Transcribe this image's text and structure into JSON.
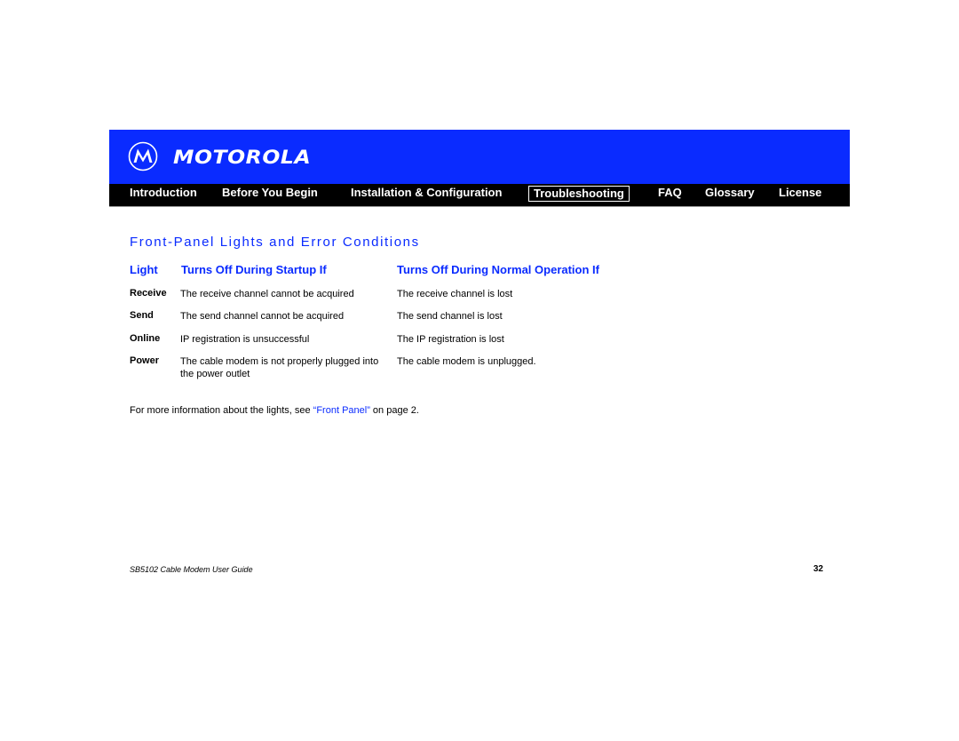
{
  "header": {
    "brand": "MOTOROLA",
    "logo_icon": "motorola-batwing-logo-icon",
    "colors": {
      "banner": "#0a2bff",
      "navbar": "#000000",
      "accent": "#0a2bff"
    }
  },
  "nav": {
    "items": [
      {
        "label": "Introduction"
      },
      {
        "label": "Before You Begin"
      },
      {
        "label": "Installation & Configuration"
      },
      {
        "label": "Troubleshooting",
        "active": true
      },
      {
        "label": "FAQ"
      },
      {
        "label": "Glossary"
      },
      {
        "label": "License"
      }
    ]
  },
  "content": {
    "title": "Front-Panel Lights and Error Conditions",
    "table": {
      "headers": [
        "Light",
        "Turns Off During Startup If",
        "Turns Off During Normal Operation If"
      ],
      "rows": [
        {
          "light": "Receive",
          "startup": "The receive channel cannot be acquired",
          "normal": "The receive channel is lost"
        },
        {
          "light": "Send",
          "startup": "The send channel cannot be acquired",
          "normal": "The send channel is lost"
        },
        {
          "light": "Online",
          "startup": "IP registration is unsuccessful",
          "normal": "The IP registration is lost"
        },
        {
          "light": "Power",
          "startup": "The cable modem is not properly plugged into",
          "startup_line2": "the power outlet",
          "normal": "The cable modem is unplugged."
        }
      ]
    },
    "note": {
      "prefix": "For more information about the lights, see ",
      "link": "“Front Panel”",
      "suffix": " on page 2."
    }
  },
  "footer": {
    "doc_title": "SB5102 Cable Modem User Guide",
    "page_number": "32"
  }
}
